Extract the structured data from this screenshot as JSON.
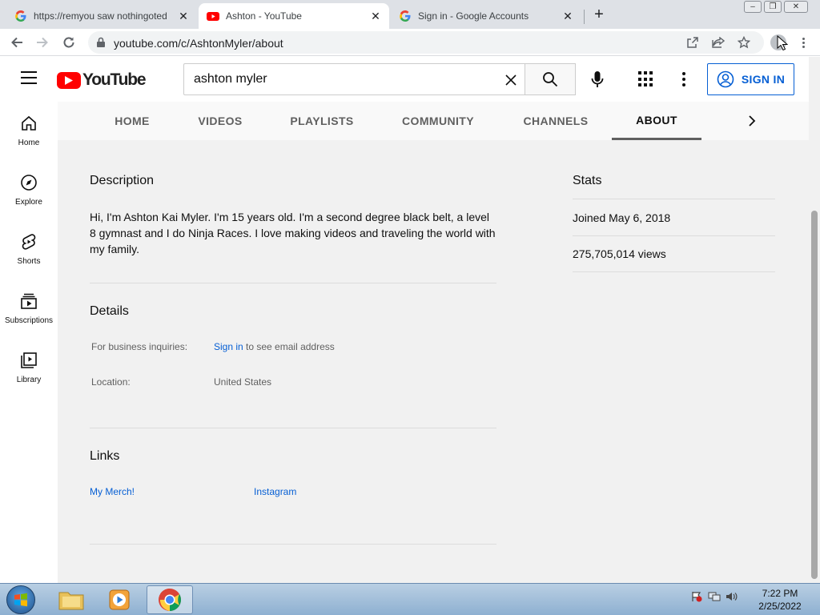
{
  "browser": {
    "tabs": [
      {
        "title": "https://remyou saw nothingoted",
        "favicon": "google-g-icon",
        "active": false
      },
      {
        "title": "Ashton - YouTube",
        "favicon": "youtube-icon",
        "active": true
      },
      {
        "title": "Sign in - Google Accounts",
        "favicon": "google-g-icon",
        "active": false
      }
    ],
    "url": "youtube.com/c/AshtonMyler/about"
  },
  "masthead": {
    "logo_text": "YouTube",
    "search_value": "ashton myler",
    "sign_in_label": "SIGN IN"
  },
  "guide": {
    "items": [
      {
        "label": "Home",
        "icon": "home-icon"
      },
      {
        "label": "Explore",
        "icon": "compass-icon"
      },
      {
        "label": "Shorts",
        "icon": "shorts-icon"
      },
      {
        "label": "Subscriptions",
        "icon": "subscriptions-icon"
      },
      {
        "label": "Library",
        "icon": "library-icon"
      }
    ]
  },
  "channel_tabs": [
    {
      "label": "HOME",
      "active": false
    },
    {
      "label": "VIDEOS",
      "active": false
    },
    {
      "label": "PLAYLISTS",
      "active": false
    },
    {
      "label": "COMMUNITY",
      "active": false
    },
    {
      "label": "CHANNELS",
      "active": false
    },
    {
      "label": "ABOUT",
      "active": true
    }
  ],
  "about": {
    "description_heading": "Description",
    "description_text": "Hi, I'm Ashton Kai Myler. I'm 15 years old. I'm a second degree black belt, a level 8 gymnast and I do Ninja Races. I love making videos and traveling the world with my family.",
    "details_heading": "Details",
    "business_label": "For business inquiries:",
    "business_sign_in": "Sign in",
    "business_suffix": " to see email address",
    "location_label": "Location:",
    "location_value": "United States",
    "links_heading": "Links",
    "links": [
      "My Merch!",
      "Instagram"
    ]
  },
  "stats": {
    "heading": "Stats",
    "joined": "Joined May 6, 2018",
    "views": "275,705,014 views"
  },
  "taskbar": {
    "time": "7:22 PM",
    "date": "2/25/2022"
  },
  "colors": {
    "youtube_red": "#ff0000",
    "link_blue": "#065fd4",
    "content_bg": "#f1f1f1"
  }
}
